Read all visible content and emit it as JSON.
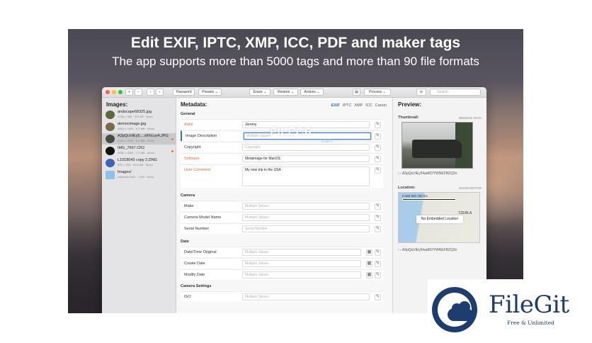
{
  "banner": {
    "title": "Edit EXIF, IPTC, XMP, ICC, PDF and maker tags",
    "subtitle": "The app supports more than 5000 tags and more than 90 file formats"
  },
  "toolbar": {
    "add": "+",
    "remove": "−",
    "back": "‹",
    "forward": "›",
    "password": "Password",
    "presets": "Presets ⌄",
    "erase": "Erase ⌄",
    "restore": "Restore ⌄",
    "actions": "Actions ⌄",
    "process": "Process ⌄",
    "search_placeholder": "Search"
  },
  "images": {
    "title": "Images:",
    "items": [
      {
        "name": "andscape68325.jpg",
        "meta": "1238 × 986 · 375 KB · Mono",
        "thumb": "#5a6a3a",
        "modified": false
      },
      {
        "name": "democimage.jpg",
        "meta": "4963 × 2426 · 5.3 MB · Mono",
        "thumb": "#7a6a4a",
        "modified": false
      },
      {
        "name": "A3pQuViEy5....vlF6cuv4.JPG",
        "meta": "6000 × 4000 · 8.9 MB · Mono",
        "thumb": "#4a4a42",
        "modified": true
      },
      {
        "name": "IMG_7667.CR2",
        "meta": "4896 × 3264 · 7.0 MB · Mono",
        "thumb": "#111111",
        "modified": true
      },
      {
        "name": "L1018043 copy 2.DNG",
        "meta": "333 × 345 · 10.8 MB · Mono",
        "thumb": "#3a66b4",
        "modified": false
      },
      {
        "name": "Images/",
        "meta": "Unknown Size · 1 KB · Mono",
        "thumb": "#8ec2ec",
        "modified": false
      }
    ]
  },
  "metadata": {
    "title": "Metadata:",
    "tabs": [
      "EXIF",
      "IPTC",
      "XMP",
      "ICC",
      "Canon"
    ],
    "active_tab": "EXIF",
    "general": {
      "title": "General",
      "rows": [
        {
          "label": "Artist",
          "value": "Jeremy",
          "placeholder": false
        },
        {
          "label": "Image Description",
          "value": "Multiple Values",
          "placeholder": true
        },
        {
          "label": "Copyright",
          "value": "Copyright",
          "placeholder": true
        },
        {
          "label": "Software",
          "value": "Metaimage for MacOS",
          "placeholder": false
        },
        {
          "label": "User Comment",
          "value": "My new trip in the USA",
          "placeholder": false
        }
      ]
    },
    "camera": {
      "title": "Camera",
      "rows": [
        {
          "label": "Make",
          "value": "Multiple Values"
        },
        {
          "label": "Camera Model Name",
          "value": "Multiple Values"
        },
        {
          "label": "Serial Number",
          "value": "Serial Number"
        }
      ]
    },
    "date": {
      "title": "Date",
      "rows": [
        {
          "label": "Date/Time Original",
          "value": "Multiple Values"
        },
        {
          "label": "Create Date",
          "value": "Multiple Values"
        },
        {
          "label": "Modify Date",
          "value": "Multiple Values"
        }
      ]
    },
    "camera_settings": {
      "title": "Camera Settings",
      "rows": [
        {
          "label": "ISO",
          "value": "Multiple Values"
        }
      ]
    }
  },
  "preview": {
    "title": "Preview:",
    "thumbnail_label": "Thumbnail:",
    "remove_data": "REMOVE DATA",
    "thumb_nav": "‹  ›   A3pQuViEy54adKDYWNEFB2Q2n",
    "location_label": "Location:",
    "show_editor": "SHOW EDITOR",
    "map_scale": "0      250     500     750 km",
    "map_country": "TZERLA",
    "no_location": "No Embedded Location",
    "location_nav": "‹  ›   A3pQuViEy54adKDYWNEFB2Q2n"
  },
  "watermarks": {
    "filecr": "FILECR",
    "filecr_sub": ".com",
    "filegit_name": "FileGit",
    "filegit_tag": "Free & Unlimited"
  },
  "colors": {
    "accent": "#2a6fdb",
    "modified_dot": "#f08030",
    "required_label": "#e06a2a",
    "filegit_brand": "#1c3d6e"
  }
}
